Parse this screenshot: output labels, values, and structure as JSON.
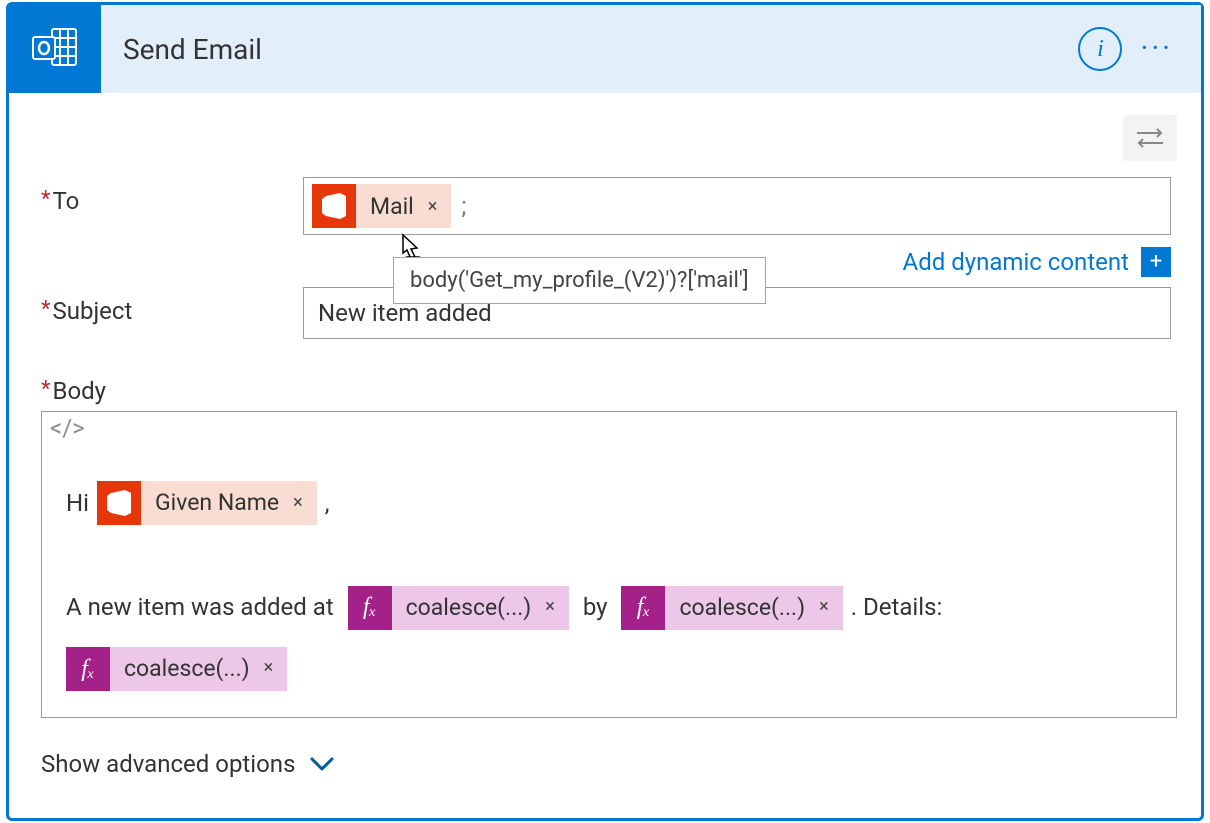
{
  "header": {
    "title": "Send Email",
    "info_label": "i",
    "more_label": "···"
  },
  "fields": {
    "to": {
      "label": "To",
      "tokens": [
        {
          "type": "office",
          "label": "Mail"
        }
      ],
      "separator": ";",
      "tooltip": "body('Get_my_profile_(V2)')?['mail']"
    },
    "subject": {
      "label": "Subject",
      "value": "New item added"
    },
    "body": {
      "label": "Body",
      "code_toggle": "</>",
      "content": {
        "line1_pre": "Hi",
        "line1_token": {
          "type": "office",
          "label": "Given Name"
        },
        "line1_post": ",",
        "line2_pre": "A new item was added at ",
        "line2_token1": {
          "type": "fx",
          "label": "coalesce(...)"
        },
        "line2_mid": " by ",
        "line2_token2": {
          "type": "fx",
          "label": "coalesce(...)"
        },
        "line2_post": ". Details:",
        "line3_token": {
          "type": "fx",
          "label": "coalesce(...)"
        }
      }
    }
  },
  "dynamic_content_label": "Add dynamic content",
  "advanced_label": "Show advanced options",
  "token_remove": "×",
  "fx_label": "fₓ",
  "plus_label": "+"
}
